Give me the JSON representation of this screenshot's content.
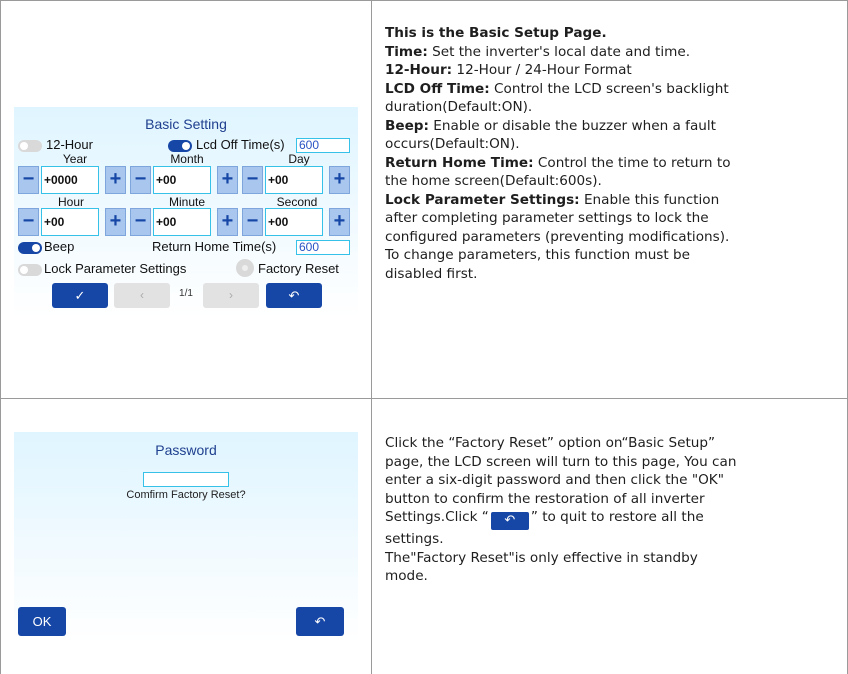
{
  "basic_setting": {
    "title": "Basic Setting",
    "hour12_label": "12-Hour",
    "lcd_off_label": "Lcd Off Time(s)",
    "lcd_off_value": "600",
    "year_label": "Year",
    "month_label": "Month",
    "day_label": "Day",
    "year_value": "+0000",
    "month_value": "+00",
    "day_value": "+00",
    "hour_label": "Hour",
    "minute_label": "Minute",
    "second_label": "Second",
    "hour_value": "+00",
    "minute_value": "+00",
    "second_value": "+00",
    "beep_label": "Beep",
    "return_home_label": "Return Home Time(s)",
    "return_home_value": "600",
    "lock_label": "Lock Parameter Settings",
    "factory_reset_label": "Factory Reset",
    "page_indicator": "1/1",
    "minus": "−",
    "plus": "+",
    "ok_glyph": "✓",
    "prev_glyph": "‹",
    "next_glyph": "›",
    "back_glyph": "↶"
  },
  "password_screen": {
    "title": "Password",
    "confirm_text": "Comfirm Factory Reset?",
    "ok_label": "OK",
    "back_glyph": "↶"
  },
  "description1": {
    "heading": "This is the Basic Setup Page.",
    "time_term": "Time:",
    "time_text": " Set the inverter's local date and time.",
    "hour12_term": "12-Hour:",
    "hour12_text": " 12-Hour / 24-Hour Format",
    "lcd_term": "LCD Off Time:",
    "lcd_text_1": " Control the LCD screen's backlight",
    "lcd_text_2": "duration(Default:ON).",
    "beep_term": "Beep:",
    "beep_text_1": " Enable or disable the buzzer when a fault",
    "beep_text_2": "occurs(Default:ON).",
    "return_term": "Return Home Time:",
    "return_text_1": " Control the time to return to",
    "return_text_2": "the home screen(Default:600s).",
    "lock_term": "Lock Parameter Settings:",
    "lock_text_1": " Enable this function",
    "lock_text_2": "after completing parameter settings to lock the",
    "lock_text_3": "configured parameters (preventing modifications).",
    "lock_text_4": "To change parameters, this function must be",
    "lock_text_5": "disabled first."
  },
  "description2": {
    "line1": "Click the “Factory Reset” option on“Basic Setup”",
    "line2": "page, the LCD screen will turn to this page, You can",
    "line3": "enter a six-digit password and then click the \"OK\"",
    "line4": "button to confirm the restoration of all inverter",
    "line5a": "Settings.Click “",
    "line5b": "” to quit to restore all the",
    "line6": "settings.",
    "line7": "The\"Factory Reset\"is only effective in standby",
    "line8": "mode.",
    "inline_glyph": "↶"
  }
}
